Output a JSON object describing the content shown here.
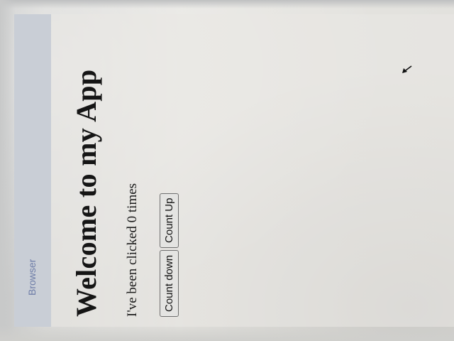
{
  "browser": {
    "label": "Browser"
  },
  "app": {
    "title": "Welcome to my App",
    "click_text": "I've been clicked 0 times",
    "buttons": {
      "count_down": "Count down",
      "count_up": "Count Up"
    }
  },
  "colors": {
    "browser_bar": "#c9ced6",
    "browser_label": "#6f7ea8",
    "button_border": "#6f6f6f"
  }
}
